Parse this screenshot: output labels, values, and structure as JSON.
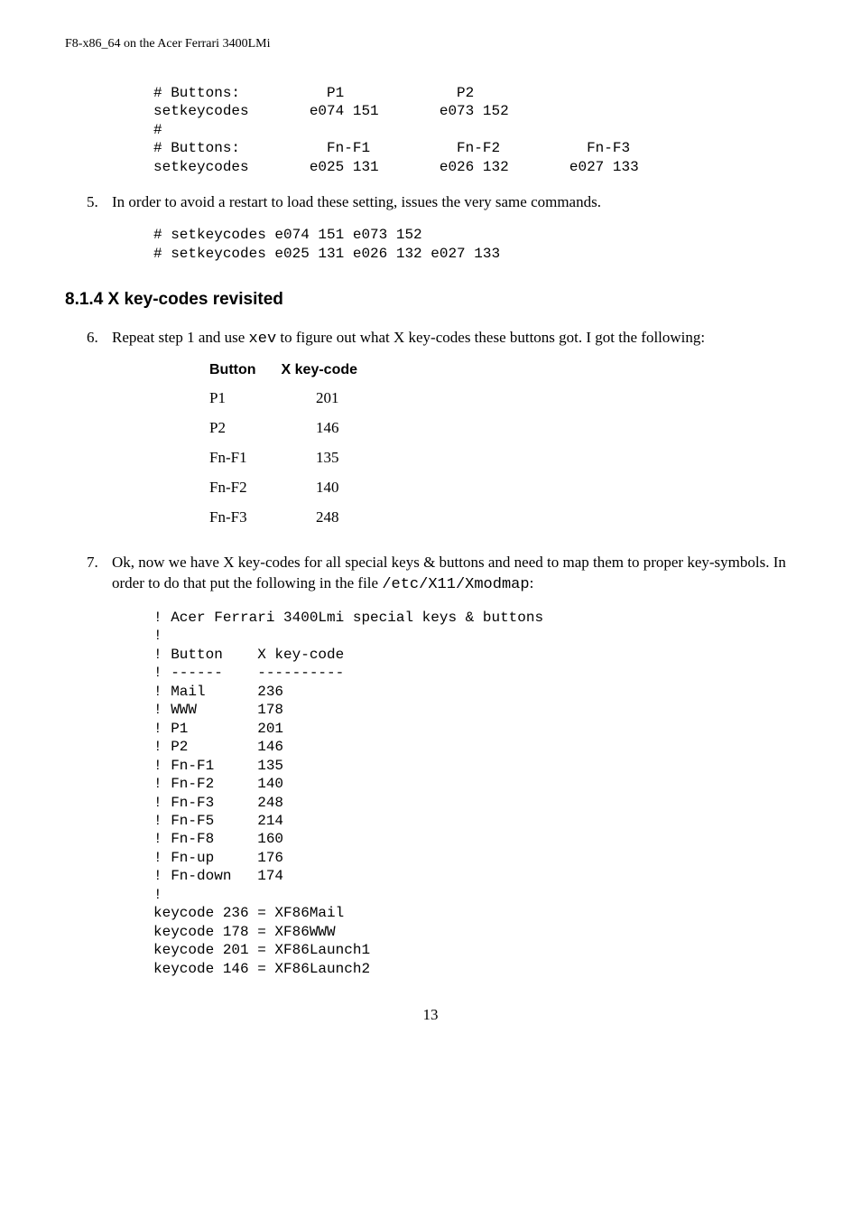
{
  "header": "F8-x86_64 on the Acer Ferrari 3400LMi",
  "code1": "# Buttons:          P1             P2\nsetkeycodes       e074 151       e073 152\n#\n# Buttons:          Fn-F1          Fn-F2          Fn-F3\nsetkeycodes       e025 131       e026 132       e027 133",
  "step5_num": "5.",
  "step5_text": "In order to avoid a restart to load these setting, issues the very same commands.",
  "code2": "# setkeycodes e074 151 e073 152\n# setkeycodes e025 131 e026 132 e027 133",
  "section_title": "8.1.4 X key-codes revisited",
  "step6_num": "6.",
  "step6_text_a": "Repeat step 1 and use ",
  "step6_mono": "xev",
  "step6_text_b": " to figure out what X key-codes these buttons got. I got the following:",
  "table": {
    "head": [
      "Button",
      "X key-code"
    ],
    "rows": [
      [
        "P1",
        "201"
      ],
      [
        "P2",
        "146"
      ],
      [
        "Fn-F1",
        "135"
      ],
      [
        "Fn-F2",
        "140"
      ],
      [
        "Fn-F3",
        "248"
      ]
    ]
  },
  "step7_num": "7.",
  "step7_text_a": "Ok, now we have X key-codes for all special keys & buttons and need to map them to proper key-symbols. In order to do that put the following in the file ",
  "step7_mono": "/etc/X11/Xmodmap",
  "step7_text_b": ":",
  "code3": "! Acer Ferrari 3400Lmi special keys & buttons\n!\n! Button    X key-code\n! ------    ----------\n! Mail      236\n! WWW       178\n! P1        201\n! P2        146\n! Fn-F1     135\n! Fn-F2     140\n! Fn-F3     248\n! Fn-F5     214\n! Fn-F8     160\n! Fn-up     176\n! Fn-down   174\n!\nkeycode 236 = XF86Mail\nkeycode 178 = XF86WWW\nkeycode 201 = XF86Launch1\nkeycode 146 = XF86Launch2",
  "page_number": "13"
}
